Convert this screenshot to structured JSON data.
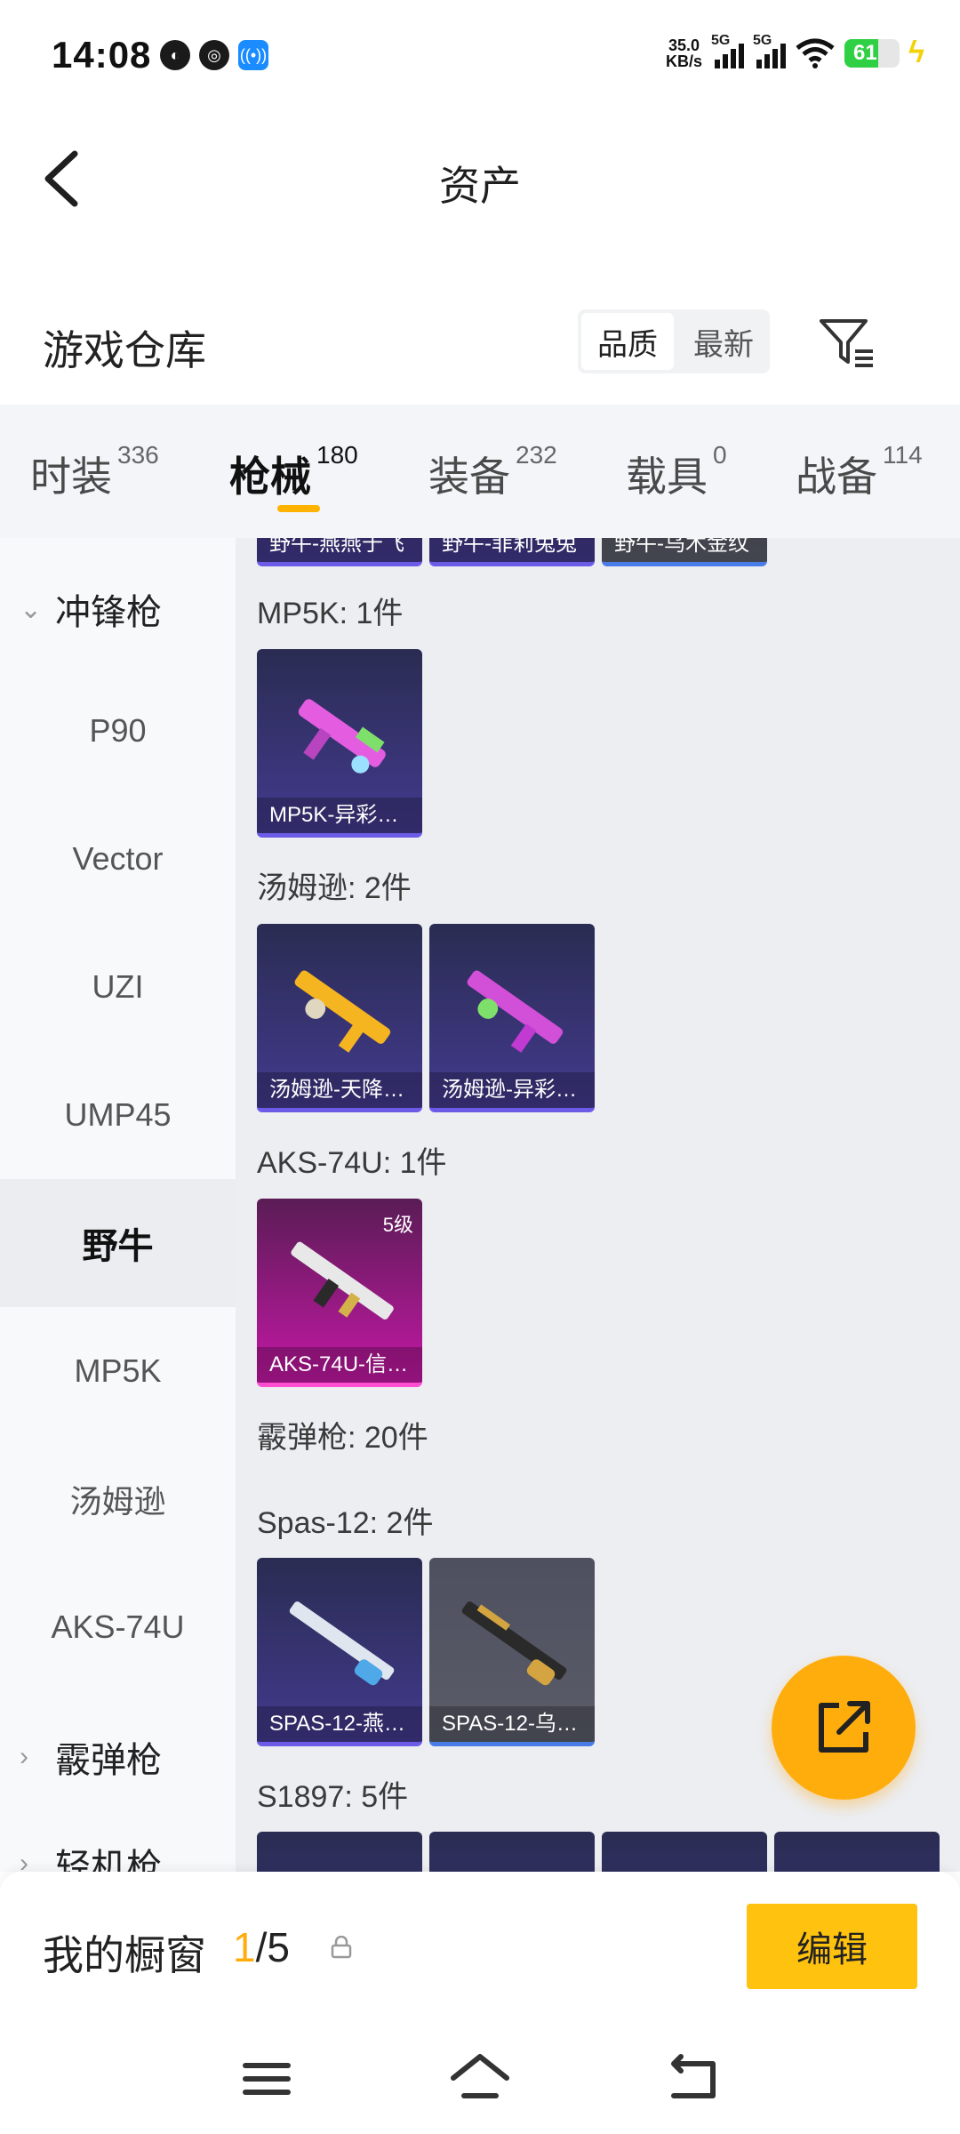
{
  "status": {
    "time": "14:08",
    "net_speed_value": "35.0",
    "net_speed_unit": "KB/s",
    "sig1_label": "5G",
    "sig2_label": "5G",
    "battery": "61",
    "colors": {
      "battery": "#2fd043",
      "bolt": "#f3d20a"
    }
  },
  "header": {
    "title": "资产"
  },
  "warehouse": {
    "title": "游戏仓库",
    "sort_quality": "品质",
    "sort_latest": "最新"
  },
  "tabs": [
    {
      "label": "时装",
      "count": "336"
    },
    {
      "label": "枪械",
      "count": "180"
    },
    {
      "label": "装备",
      "count": "232"
    },
    {
      "label": "载具",
      "count": "0"
    },
    {
      "label": "战备",
      "count": "114"
    }
  ],
  "sidebar": {
    "group_smg": "冲锋枪",
    "items": [
      "P90",
      "Vector",
      "UZI",
      "UMP45",
      "野牛",
      "MP5K",
      "汤姆逊",
      "AKS-74U"
    ],
    "group_shotgun": "霰弹枪",
    "group_next": "轻机枪"
  },
  "content": {
    "top_partial_labels": [
      "野牛-燕燕于飞",
      "野牛-菲莉兔兔",
      "野牛-乌木金纹"
    ],
    "sections": {
      "mp5k": {
        "title": "MP5K: 1件",
        "cards": [
          {
            "label": "MP5K-异彩…"
          }
        ]
      },
      "thompson": {
        "title": "汤姆逊: 2件",
        "cards": [
          {
            "label": "汤姆逊-天降…"
          },
          {
            "label": "汤姆逊-异彩…"
          }
        ]
      },
      "aks": {
        "title": "AKS-74U: 1件",
        "cards": [
          {
            "label": "AKS-74U-信…",
            "level": "5级"
          }
        ]
      },
      "shotgun": {
        "title": "霰弹枪: 20件"
      },
      "spas": {
        "title": "Spas-12: 2件",
        "cards": [
          {
            "label": "SPAS-12-燕…"
          },
          {
            "label": "SPAS-12-乌…"
          }
        ]
      },
      "s1897": {
        "title": "S1897: 5件"
      }
    }
  },
  "showcase": {
    "title": "我的橱窗",
    "current": "1",
    "total": "/5",
    "edit_label": "编辑"
  },
  "colors": {
    "accent": "#ffad0d",
    "edit_button": "#ffc20e"
  }
}
